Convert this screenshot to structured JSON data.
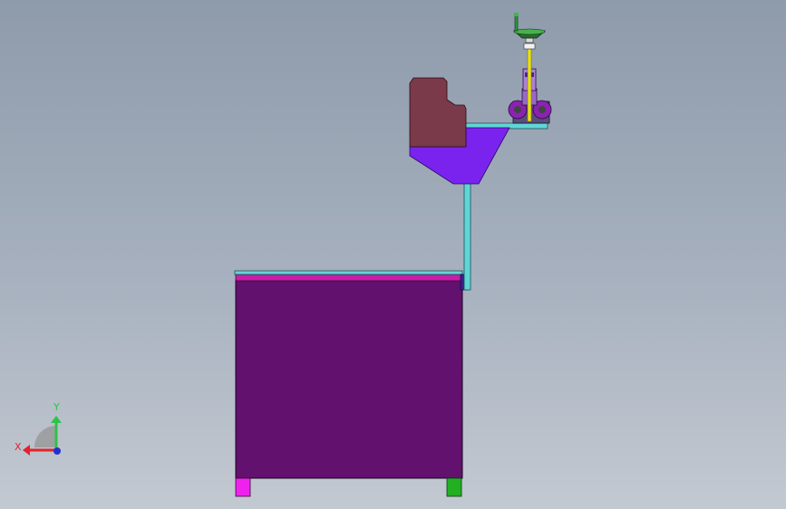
{
  "window": {
    "background_top": "#8e9bab",
    "background_bottom": "#c3c9d1"
  },
  "triad": {
    "x_label": "X",
    "y_label": "Y",
    "x_color": "#e3222a",
    "y_color": "#2ec24a",
    "z_color": "#2233cc"
  },
  "colors": {
    "cabinet_body": "#62116f",
    "cabinet_top_plate": "#5fd6d6",
    "cabinet_top_strip": "#c81fa8",
    "foot_left": "#ee22ee",
    "foot_right": "#22b022",
    "frame_tube": "#5fd6d6",
    "hopper": "#7a22ee",
    "block": "#7a3a4a",
    "roller": "#8a23b2",
    "cylinder": "#e8e022",
    "handle": "#2e9a3a"
  }
}
